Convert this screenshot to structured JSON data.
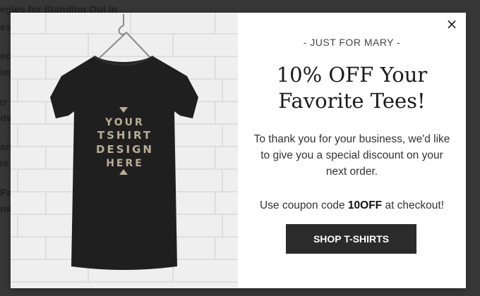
{
  "background_page": {
    "fragments": [
      "egies for Standing Out in",
      "ess",
      "ec",
      "ieg",
      "tr",
      "dv",
      "ais",
      "is",
      "Per",
      "na"
    ]
  },
  "modal": {
    "close_icon": "×",
    "eyebrow": "- JUST FOR MARY -",
    "headline_line1": "10% OFF Your",
    "headline_line2": "Favorite Tees!",
    "body": "To thank you for your business, we'd like to give you a special discount on your next order.",
    "coupon_prefix": "Use coupon code ",
    "coupon_code": "10OFF",
    "coupon_suffix": " at checkout!",
    "button_label": "SHOP T-SHIRTS",
    "image": {
      "shirt_text": [
        "YOUR",
        "TSHIRT",
        "DESIGN",
        "HERE"
      ]
    }
  },
  "colors": {
    "button_bg": "#2b2b2b",
    "shirt": "#1f1f1f",
    "shirt_print": "#b8ad96",
    "overlay": "#3a3a3a"
  }
}
